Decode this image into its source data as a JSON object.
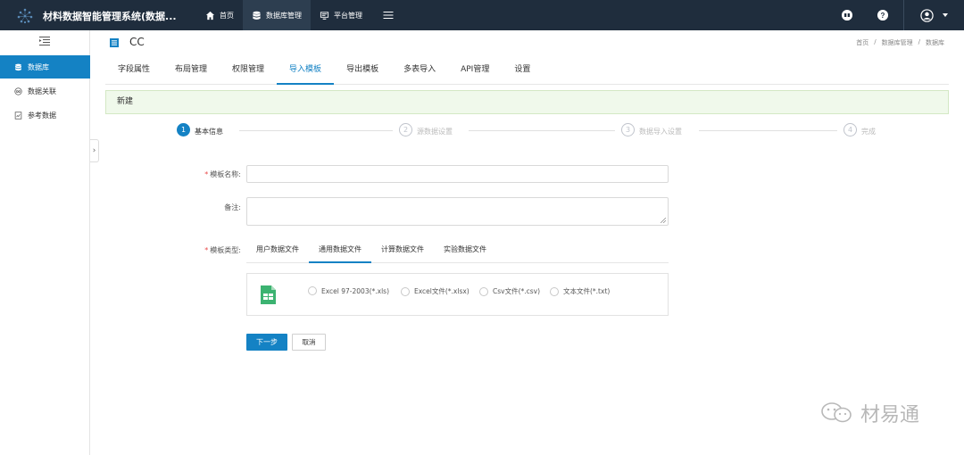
{
  "topbar": {
    "app_title": "材料数据智能管理系统(数据...",
    "nav": [
      {
        "label": "首页",
        "icon": "home-icon"
      },
      {
        "label": "数据库管理",
        "icon": "database-icon",
        "active": true
      },
      {
        "label": "平台管理",
        "icon": "monitor-icon"
      }
    ],
    "right_icons": [
      "globe-icon",
      "help-icon",
      "user-avatar-icon"
    ]
  },
  "sidebar": {
    "items": [
      {
        "label": "数据库",
        "icon": "database-icon",
        "active": true
      },
      {
        "label": "数据关联",
        "icon": "link-icon"
      },
      {
        "label": "参考数据",
        "icon": "document-icon"
      }
    ]
  },
  "header": {
    "title": "CC",
    "breadcrumb": [
      "首页",
      "/",
      "数据库管理",
      "/",
      "数据库"
    ]
  },
  "tabs": [
    "字段属性",
    "布局管理",
    "权限管理",
    "导入模板",
    "导出模板",
    "多表导入",
    "API管理",
    "设置"
  ],
  "active_tab": "导入模板",
  "banner": {
    "text": "新建"
  },
  "steps": [
    {
      "num": "1",
      "label": "基本信息",
      "active": true
    },
    {
      "num": "2",
      "label": "源数据设置"
    },
    {
      "num": "3",
      "label": "数据导入设置"
    },
    {
      "num": "4",
      "label": "完成"
    }
  ],
  "form": {
    "template_name_label": "模板名称:",
    "template_name_value": "",
    "remark_label": "备注:",
    "remark_value": "",
    "template_type_label": "模板类型:",
    "type_tabs": [
      "用户数据文件",
      "通用数据文件",
      "计算数据文件",
      "实验数据文件"
    ],
    "active_type_tab": "通用数据文件",
    "file_options": [
      "Excel 97-2003(*.xls)",
      "Excel文件(*.xlsx)",
      "Csv文件(*.csv)",
      "文本文件(*.txt)"
    ],
    "next_button": "下一步",
    "cancel_button": "取消"
  },
  "watermark": {
    "text": "材易通"
  },
  "colors": {
    "topbar": "#1f2d3d",
    "accent": "#1482c4",
    "banner_bg": "#f0f9eb",
    "required": "#e84a4a",
    "excel_green": "#3cb371"
  }
}
